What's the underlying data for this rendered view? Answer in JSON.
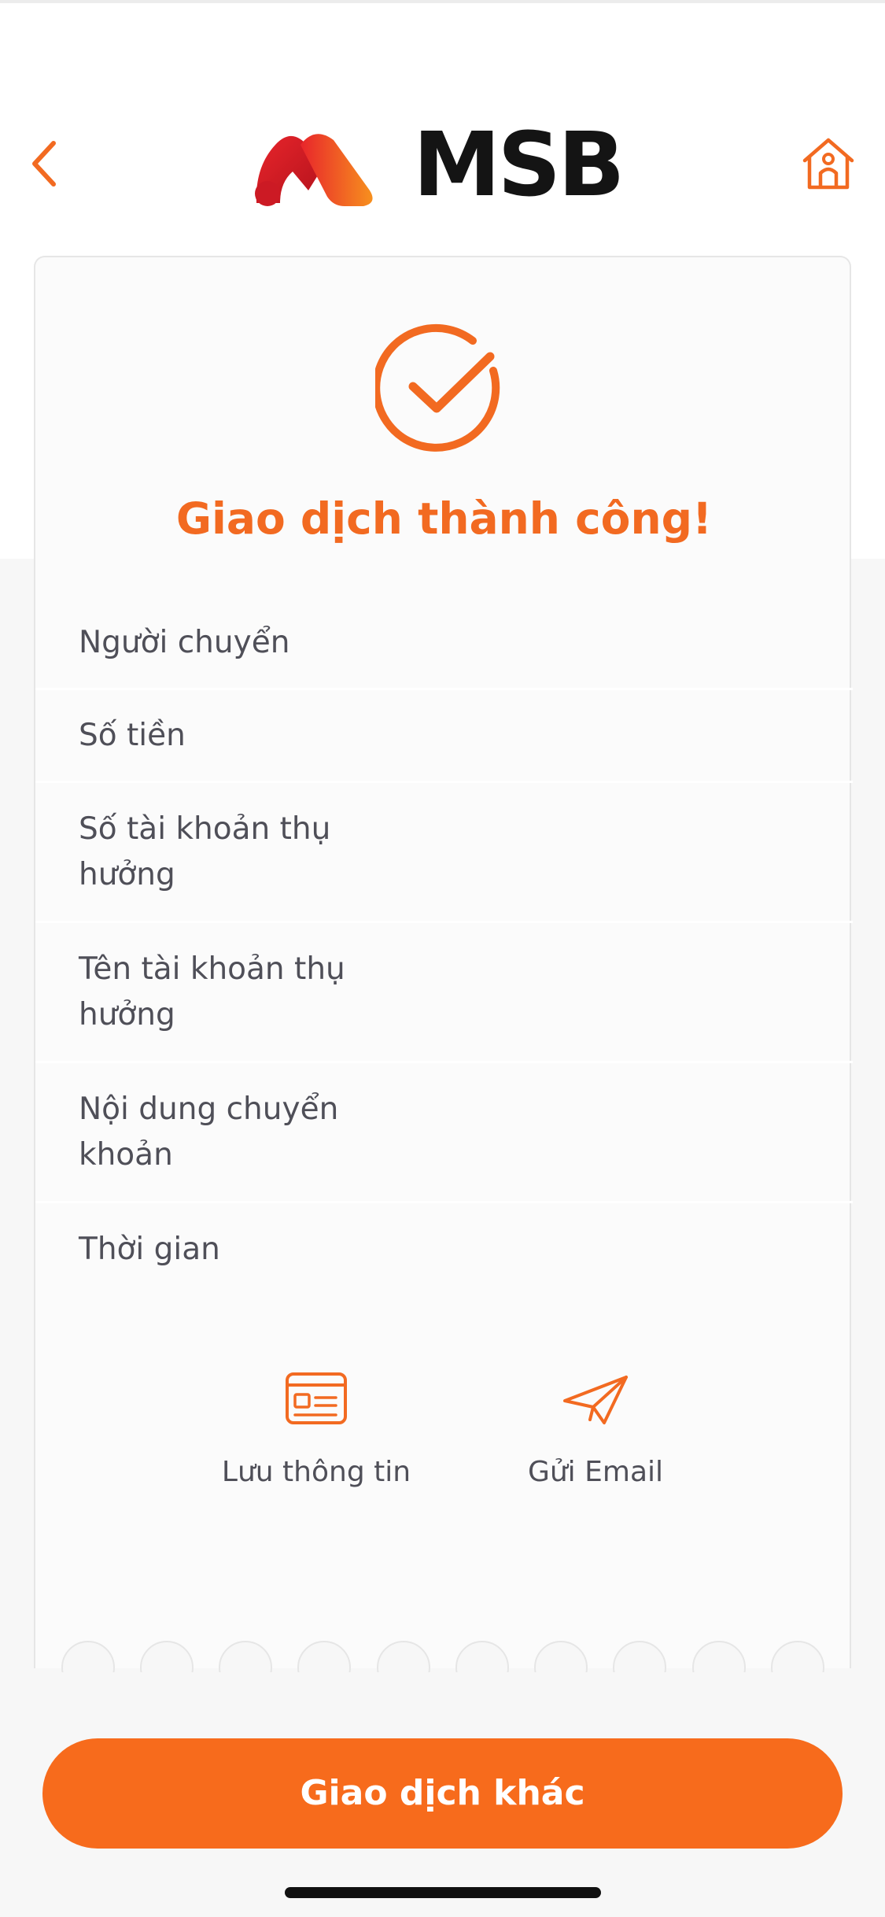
{
  "app": {
    "brand": "MSB"
  },
  "header": {
    "back_icon": "chevron-left-icon",
    "home_icon": "home-icon"
  },
  "result": {
    "title": "Giao dịch thành công!",
    "icon": "check-circle-icon"
  },
  "details": [
    {
      "label": "Người chuyển"
    },
    {
      "label": "Số tiền"
    },
    {
      "label": "Số tài khoản thụ hưởng"
    },
    {
      "label": "Tên tài khoản thụ hưởng"
    },
    {
      "label": "Nội dung chuyển khoản"
    },
    {
      "label": "Thời gian"
    }
  ],
  "actions": {
    "save_label": "Lưu thông tin",
    "email_label": "Gửi Email"
  },
  "cta": {
    "label": "Giao dịch khác"
  },
  "colors": {
    "accent": "#f26a21",
    "button": "#f76b1c"
  }
}
